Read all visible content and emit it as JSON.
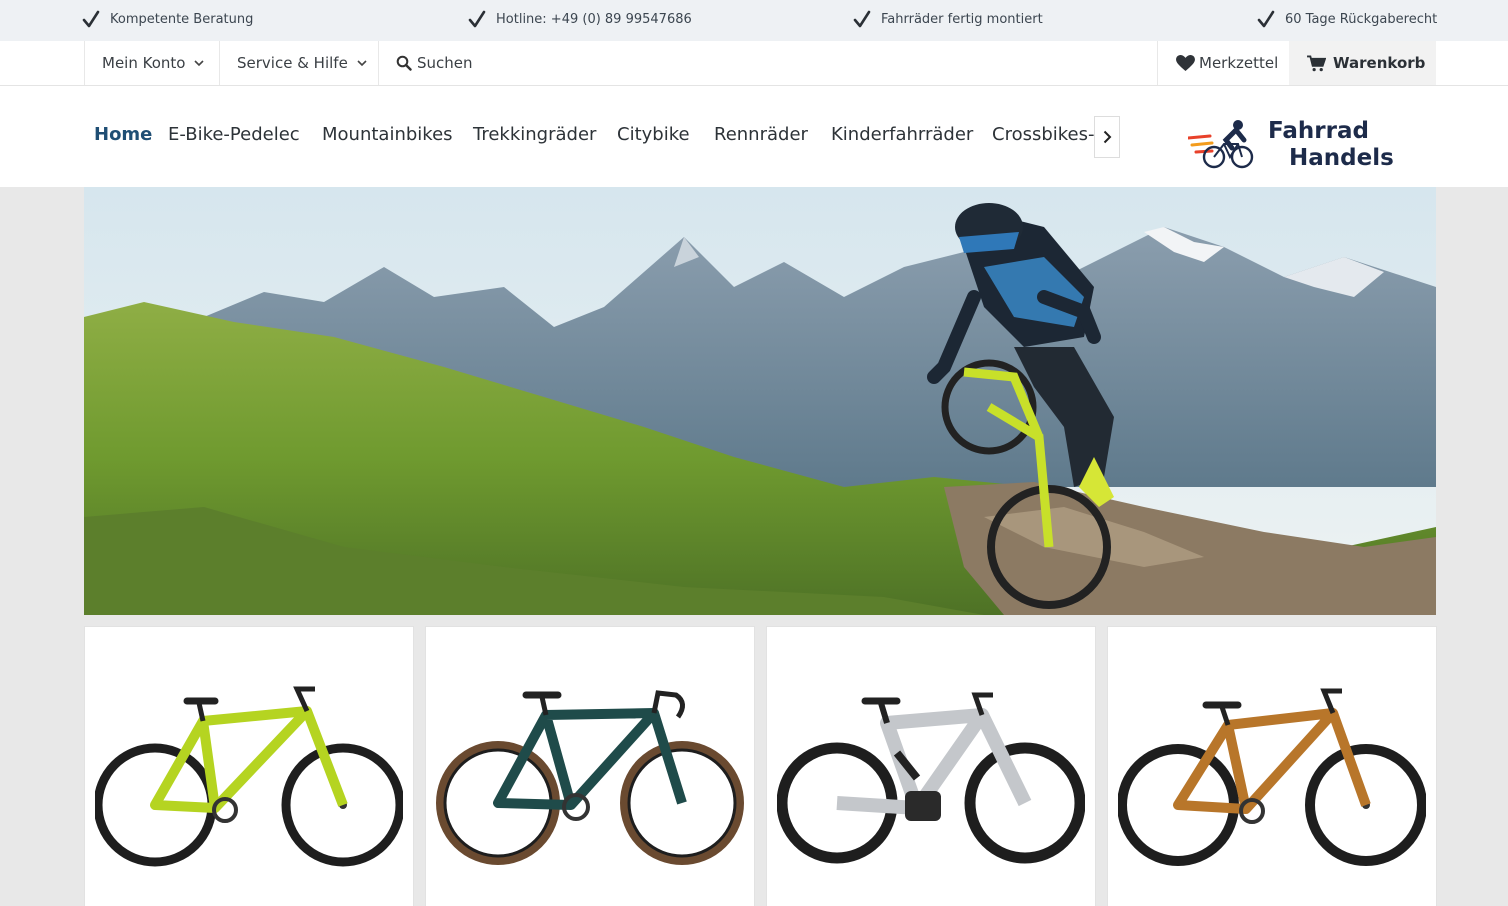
{
  "usp_bar": {
    "items": [
      {
        "icon": "checkmark-icon",
        "text": "Kompetente Beratung"
      },
      {
        "icon": "checkmark-icon",
        "text": "Hotline: +49 (0) 89 99547686"
      },
      {
        "icon": "checkmark-icon",
        "text": "Fahrräder fertig montiert"
      },
      {
        "icon": "checkmark-icon",
        "text": "60 Tage Rückgaberecht"
      }
    ]
  },
  "top_nav": {
    "account": "Mein Konto",
    "service": "Service & Hilfe",
    "search": "Suchen",
    "wishlist": "Merkzettel",
    "cart": "Warenkorb"
  },
  "main_nav": {
    "items": [
      {
        "label": "Home",
        "active": true
      },
      {
        "label": "E-Bike-Pedelec"
      },
      {
        "label": "Mountainbikes"
      },
      {
        "label": "Trekkingräder"
      },
      {
        "label": "Citybike"
      },
      {
        "label": "Rennräder"
      },
      {
        "label": "Kinderfahrräder"
      },
      {
        "label": "Crossbikes-Fitnessbikes"
      }
    ]
  },
  "logo": {
    "line1": "Fahrrad",
    "line2": "Handels"
  },
  "hero": {
    "icon": "mountain-biker-banner-image"
  },
  "products": [
    {
      "image": "hardtail-mountainbike-lime-image",
      "frame_color": "#b5d421"
    },
    {
      "image": "gravel-bike-teal-image",
      "frame_color": "#1f4b4a"
    },
    {
      "image": "e-mountainbike-silver-image",
      "frame_color": "#c4c7cb"
    },
    {
      "image": "hardtail-mountainbike-orange-image",
      "frame_color": "#b8762a"
    }
  ],
  "colors": {
    "accent": "#1f4e74",
    "usp_bg": "#eef1f4",
    "page_bg": "#e8e8e8"
  }
}
